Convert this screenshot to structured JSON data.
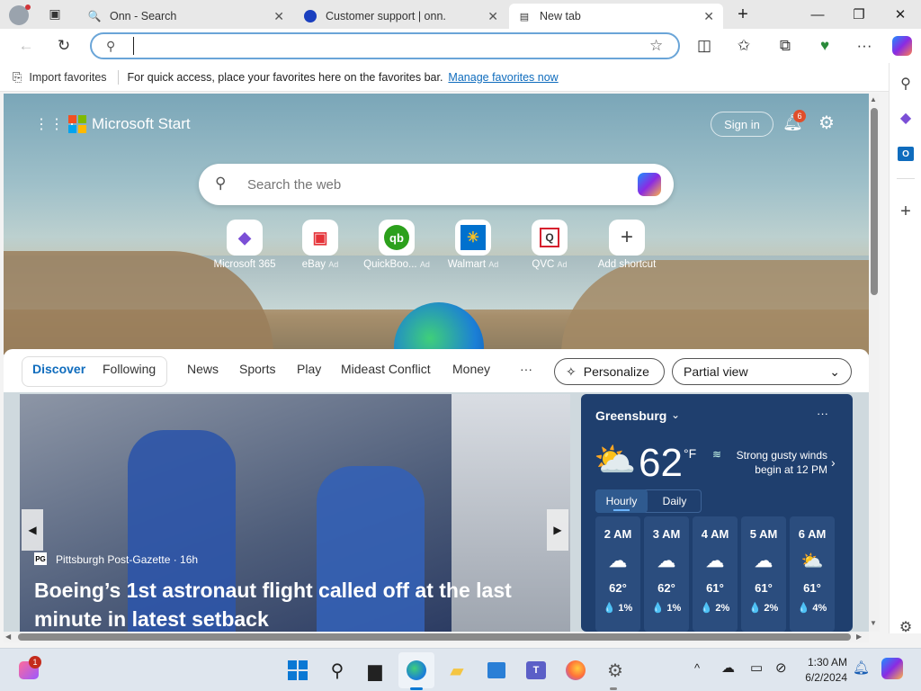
{
  "tabs": [
    {
      "title": "Onn - Search",
      "active": false
    },
    {
      "title": "Customer support | onn.",
      "active": false
    },
    {
      "title": "New tab",
      "active": true
    }
  ],
  "address": {
    "value": "",
    "placeholder": ""
  },
  "favorites_bar": {
    "import_label": "Import favorites",
    "message": "For quick access, place your favorites here on the favorites bar.",
    "manage_link": "Manage favorites now"
  },
  "brand": "Microsoft Start",
  "sign_in": "Sign in",
  "notifications_count": "6",
  "search": {
    "placeholder": "Search the web"
  },
  "shortcuts": [
    {
      "label": "Microsoft 365",
      "ad": ""
    },
    {
      "label": "eBay",
      "ad": "Ad"
    },
    {
      "label": "QuickBoo...",
      "ad": "Ad"
    },
    {
      "label": "Walmart",
      "ad": "Ad"
    },
    {
      "label": "QVC",
      "ad": "Ad"
    },
    {
      "label": "Add shortcut",
      "ad": ""
    }
  ],
  "nav": {
    "discover": "Discover",
    "following": "Following",
    "items": [
      "News",
      "Sports",
      "Play",
      "Mideast Conflict",
      "Money"
    ],
    "more": "···",
    "personalize": "Personalize",
    "partial_view": "Partial view"
  },
  "news": {
    "source": "Pittsburgh Post-Gazette · 16h",
    "headline": "Boeing’s 1st astronaut flight called off at the last minute in latest setback"
  },
  "weather": {
    "location": "Greensburg",
    "temp": "62",
    "unit": "°F",
    "alert": "Strong gusty winds begin at 12 PM",
    "tabs": [
      "Hourly",
      "Daily"
    ],
    "hours": [
      {
        "time": "2 AM",
        "temp": "62°",
        "precip": "1%"
      },
      {
        "time": "3 AM",
        "temp": "62°",
        "precip": "1%"
      },
      {
        "time": "4 AM",
        "temp": "61°",
        "precip": "2%"
      },
      {
        "time": "5 AM",
        "temp": "61°",
        "precip": "2%"
      },
      {
        "time": "6 AM",
        "temp": "61°",
        "precip": "4%"
      }
    ]
  },
  "taskbar": {
    "time": "1:30 AM",
    "date": "6/2/2024",
    "badge": "1"
  },
  "colors": {
    "accent": "#0f6cbd",
    "link": "#0f6cbd",
    "weather_bg": "#1f3f6e"
  }
}
